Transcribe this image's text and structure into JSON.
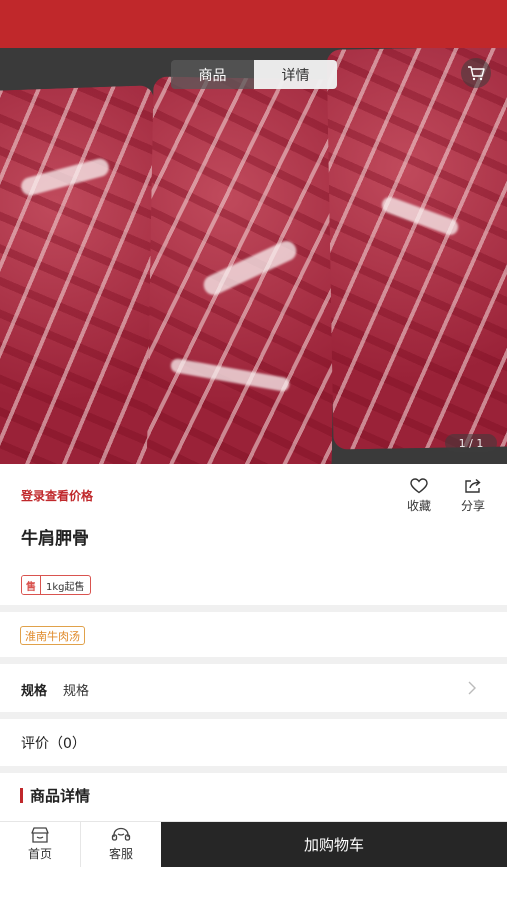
{
  "tabs": [
    {
      "label": "商品",
      "active": false
    },
    {
      "label": "详情",
      "active": true
    }
  ],
  "image": {
    "description_icon": "product-photo",
    "page_indicator": "1 / 1"
  },
  "product": {
    "login_price": "登录查看价格",
    "title": "牛肩胛骨",
    "sale_tag": "售",
    "min_order": "1kg起售",
    "store_tag": "淮南牛肉汤"
  },
  "actions": {
    "favorite_label": "收藏",
    "share_label": "分享"
  },
  "spec": {
    "key": "规格",
    "value": "规格"
  },
  "review": {
    "label": "评价（0）"
  },
  "detail": {
    "heading": "商品详情"
  },
  "bottom_nav": {
    "home_label": "首页",
    "service_label": "客服",
    "add_cart_label": "加购物车"
  },
  "colors": {
    "brand_red": "#c0282b",
    "store_tag_orange": "#e08a2a",
    "add_cart_bg": "#262626"
  }
}
